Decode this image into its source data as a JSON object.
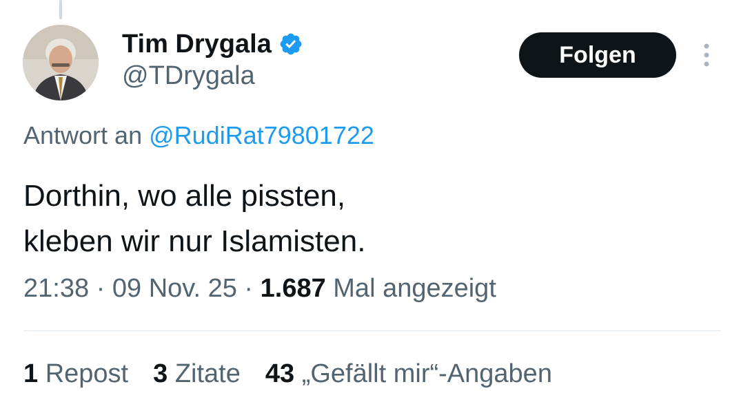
{
  "tweet": {
    "author": {
      "display_name": "Tim Drygala",
      "handle": "@TDrygala",
      "verified": true
    },
    "follow_label": "Folgen",
    "reply_to": {
      "prefix": "Antwort an",
      "mention": "@RudiRat79801722"
    },
    "text_lines": [
      "Dorthin, wo alle pissten,",
      "kleben wir nur Islamisten."
    ],
    "meta": {
      "time": "21:38",
      "separator": "·",
      "date": "09 Nov. 25",
      "views_count": "1.687",
      "views_label": "Mal angezeigt"
    },
    "stats": {
      "reposts": {
        "count": "1",
        "label": "Repost"
      },
      "quotes": {
        "count": "3",
        "label": "Zitate"
      },
      "likes": {
        "count": "43",
        "label": "„Gefällt mir“-Angaben"
      }
    }
  },
  "icons": {
    "verified": "verified-badge-icon",
    "more": "more-vertical-icon"
  },
  "colors": {
    "text": "#0f1419",
    "secondary": "#536471",
    "accent": "#1d9bf0",
    "button_bg": "#0f1419",
    "divider": "#e1e8ed"
  }
}
